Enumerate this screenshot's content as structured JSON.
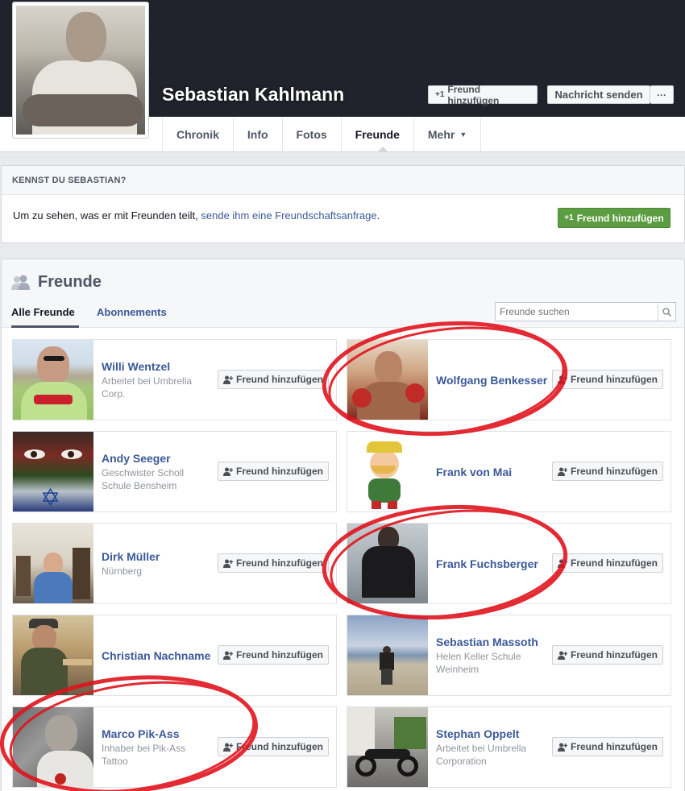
{
  "profile": {
    "name": "Sebastian Kahlmann",
    "add_friend_label": "Freund hinzufügen",
    "message_label": "Nachricht senden",
    "more_label": "···"
  },
  "tabs": [
    {
      "label": "Chronik"
    },
    {
      "label": "Info"
    },
    {
      "label": "Fotos"
    },
    {
      "label": "Freunde"
    },
    {
      "label": "Mehr"
    }
  ],
  "know_box": {
    "heading": "KENNST DU SEBASTIAN?",
    "text": "Um zu sehen, was er mit Freunden teilt, ",
    "link": "sende ihm eine Freundschaftsanfrage",
    "text_end": ".",
    "button": "Freund hinzufügen"
  },
  "friends": {
    "title": "Freunde",
    "tab_all": "Alle Freunde",
    "tab_subs": "Abonnements",
    "search_placeholder": "Freunde suchen",
    "add_label": "Freund hinzufügen",
    "list": [
      {
        "name": "Willi Wentzel",
        "sub1": "Arbeitet bei ",
        "sub_link": "Umbrella",
        "sub2": "Corp."
      },
      {
        "name": "Wolfgang Benkesser",
        "sub1": "",
        "sub_link": "",
        "sub2": ""
      },
      {
        "name": "Andy Seeger",
        "sub1": "Geschwister Scholl",
        "sub_link": "",
        "sub2": "Schule Bensheim"
      },
      {
        "name": "Frank von Mai",
        "sub1": "",
        "sub_link": "",
        "sub2": ""
      },
      {
        "name": "Dirk Müller",
        "sub1": "Nürnberg",
        "sub_link": "",
        "sub2": ""
      },
      {
        "name": "Frank Fuchsberger",
        "sub1": "",
        "sub_link": "",
        "sub2": ""
      },
      {
        "name": "Christian Nachname",
        "sub1": "",
        "sub_link": "",
        "sub2": ""
      },
      {
        "name": "Sebastian Massoth",
        "sub1": "Helen Keller Schule",
        "sub_link": "",
        "sub2": "Weinheim"
      },
      {
        "name": "Marco Pik-Ass",
        "sub1": "Inhaber bei ",
        "sub_link": "Pik-Ass",
        "sub2": "Tattoo"
      },
      {
        "name": "Stephan Oppelt",
        "sub1": "Arbeitet bei ",
        "sub_link": "Umbrella",
        "sub2": "Corporation"
      }
    ]
  },
  "colors": {
    "cover": "#20232b",
    "link": "#3b5998",
    "green_button": "#5d9d42",
    "highlight_ring": "#e0141e"
  }
}
